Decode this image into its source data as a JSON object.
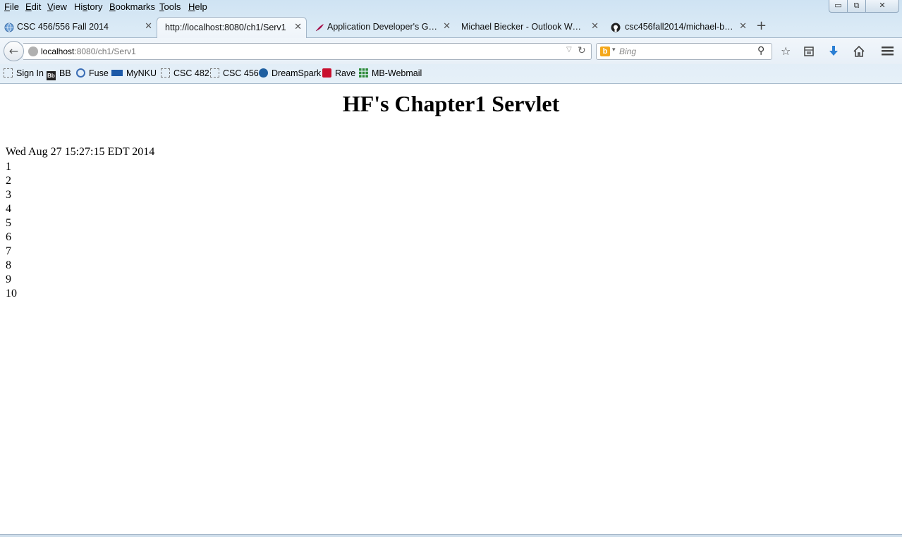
{
  "menu": [
    {
      "before": "",
      "key": "F",
      "after": "ile"
    },
    {
      "before": "",
      "key": "E",
      "after": "dit"
    },
    {
      "before": "",
      "key": "V",
      "after": "iew"
    },
    {
      "before": "Hi",
      "key": "s",
      "after": "tory"
    },
    {
      "before": "",
      "key": "B",
      "after": "ookmarks"
    },
    {
      "before": "",
      "key": "T",
      "after": "ools"
    },
    {
      "before": "",
      "key": "H",
      "after": "elp"
    }
  ],
  "window_buttons": {
    "minimize": "▭",
    "maximize": "⧉",
    "close": "✕"
  },
  "tabs": [
    {
      "label": "CSC 456/556 Fall 2014",
      "icon": "globe-icon",
      "active": false
    },
    {
      "label": "http://localhost:8080/ch1/Serv1",
      "icon": "",
      "active": true
    },
    {
      "label": "Application Developer's Gu...",
      "icon": "feather-icon",
      "active": false
    },
    {
      "label": "Michael Biecker - Outlook Web...",
      "icon": "",
      "active": false
    },
    {
      "label": "csc456fall2014/michael-bie...",
      "icon": "github-icon",
      "active": false
    }
  ],
  "tab_close_glyph": "✕",
  "new_tab_glyph": "+",
  "urlbar": {
    "host": "localhost",
    "rest": ":8080/ch1/Serv1"
  },
  "search": {
    "placeholder": "Bing",
    "engine_glyph": "b"
  },
  "toolbar_icons": [
    "star-icon",
    "reading-list-icon",
    "download-icon",
    "home-icon",
    "menu-icon"
  ],
  "bookmarks": [
    {
      "label": "Sign In",
      "icon": "page-icon"
    },
    {
      "label": "BB",
      "icon": "blackboard-icon"
    },
    {
      "label": "Fuse",
      "icon": "fuse-icon"
    },
    {
      "label": "MyNKU",
      "icon": "sap-icon"
    },
    {
      "label": "CSC 482",
      "icon": "page-icon"
    },
    {
      "label": "CSC 456",
      "icon": "page-icon"
    },
    {
      "label": "DreamSpark",
      "icon": "dreamspark-icon"
    },
    {
      "label": "Rave",
      "icon": "rave-icon"
    },
    {
      "label": "MB-Webmail",
      "icon": "webmail-icon"
    }
  ],
  "page": {
    "heading": "HF's Chapter1 Servlet",
    "date": "Wed Aug 27 15:27:15 EDT 2014",
    "lines": [
      "1",
      "2",
      "3",
      "4",
      "5",
      "6",
      "7",
      "8",
      "9",
      "10"
    ]
  }
}
